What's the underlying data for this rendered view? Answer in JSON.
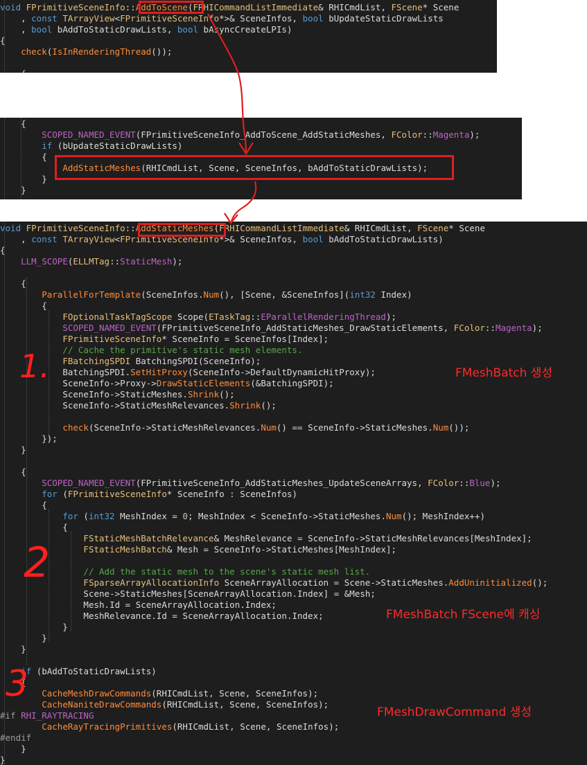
{
  "panel1": [
    "void FPrimitiveSceneInfo::AddToScene(FRHICommandListImmediate& RHICmdList, FScene* Scene",
    "    , const TArrayView<FPrimitiveSceneInfo*>& SceneInfos, bool bUpdateStaticDrawLists",
    "    , bool bAddToStaticDrawLists, bool bAsyncCreateLPIs)",
    "{",
    "    check(IsInRenderingThread());",
    "",
    "    {"
  ],
  "panel2": [
    "    {",
    "        SCOPED_NAMED_EVENT(FPrimitiveSceneInfo_AddToScene_AddStaticMeshes, FColor::Magenta);",
    "        if (bUpdateStaticDrawLists)",
    "        {",
    "            AddStaticMeshes(RHICmdList, Scene, SceneInfos, bAddToStaticDrawLists);",
    "        }",
    "    }"
  ],
  "panel3": [
    "void FPrimitiveSceneInfo::AddStaticMeshes(FRHICommandListImmediate& RHICmdList, FScene* Scene",
    "    , const TArrayView<FPrimitiveSceneInfo*>& SceneInfos, bool bAddToStaticDrawLists)",
    "{",
    "    LLM_SCOPE(ELLMTag::StaticMesh);",
    "",
    "    {",
    "        ParallelForTemplate(SceneInfos.Num(), [Scene, &SceneInfos](int32 Index)",
    "        {",
    "            FOptionalTaskTagScope Scope(ETaskTag::EParallelRenderingThread);",
    "            SCOPED_NAMED_EVENT(FPrimitiveSceneInfo_AddStaticMeshes_DrawStaticElements, FColor::Magenta);",
    "            FPrimitiveSceneInfo* SceneInfo = SceneInfos[Index];",
    "            // Cache the primitive's static mesh elements.",
    "            FBatchingSPDI BatchingSPDI(SceneInfo);",
    "            BatchingSPDI.SetHitProxy(SceneInfo->DefaultDynamicHitProxy);",
    "            SceneInfo->Proxy->DrawStaticElements(&BatchingSPDI);",
    "            SceneInfo->StaticMeshes.Shrink();",
    "            SceneInfo->StaticMeshRelevances.Shrink();",
    "",
    "            check(SceneInfo->StaticMeshRelevances.Num() == SceneInfo->StaticMeshes.Num());",
    "        });",
    "    }",
    "",
    "    {",
    "        SCOPED_NAMED_EVENT(FPrimitiveSceneInfo_AddStaticMeshes_UpdateSceneArrays, FColor::Blue);",
    "        for (FPrimitiveSceneInfo* SceneInfo : SceneInfos)",
    "        {",
    "            for (int32 MeshIndex = 0; MeshIndex < SceneInfo->StaticMeshes.Num(); MeshIndex++)",
    "            {",
    "                FStaticMeshBatchRelevance& MeshRelevance = SceneInfo->StaticMeshRelevances[MeshIndex];",
    "                FStaticMeshBatch& Mesh = SceneInfo->StaticMeshes[MeshIndex];",
    "",
    "                // Add the static mesh to the scene's static mesh list.",
    "                FSparseArrayAllocationInfo SceneArrayAllocation = Scene->StaticMeshes.AddUninitialized();",
    "                Scene->StaticMeshes[SceneArrayAllocation.Index] = &Mesh;",
    "                Mesh.Id = SceneArrayAllocation.Index;",
    "                MeshRelevance.Id = SceneArrayAllocation.Index;",
    "            }",
    "        }",
    "    }",
    "",
    "    if (bAddToStaticDrawLists)",
    "    {",
    "        CacheMeshDrawCommands(RHICmdList, Scene, SceneInfos);",
    "        CacheNaniteDrawCommands(RHICmdList, Scene, SceneInfos);",
    "#if RHI_RAYTRACING",
    "        CacheRayTracingPrimitives(RHICmdList, Scene, SceneInfos);",
    "#endif",
    "    }",
    "}"
  ],
  "annotations": {
    "label1": "FMeshBatch 생성",
    "label2": "FMeshBatch FScene에 캐싱",
    "label3": "FMeshDrawCommand 생성",
    "num1": "1.",
    "num2": "2",
    "num3": "3"
  },
  "colors": {
    "editor_bg": "#1e1e1e",
    "annotation_red": "#e01e1e",
    "highlight_orange": "#ff8c3a"
  }
}
